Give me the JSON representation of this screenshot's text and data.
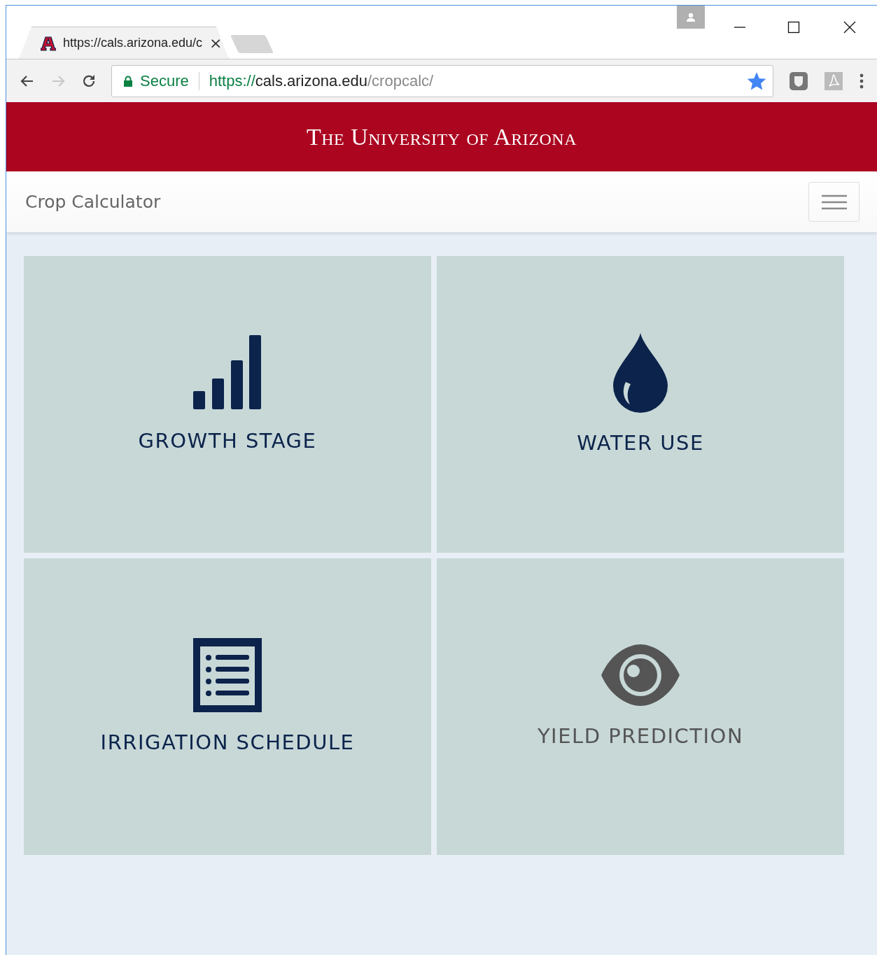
{
  "browser": {
    "tab": {
      "title": "https://cals.arizona.edu/c",
      "close": "×"
    },
    "address": {
      "secure_label": "Secure",
      "scheme": "https://",
      "host": "cals.arizona.edu",
      "path": "/cropcalc/",
      "bookmarked": true
    }
  },
  "banner": {
    "title": "The University of Arizona"
  },
  "navbar": {
    "brand": "Crop Calculator"
  },
  "tiles": [
    {
      "kind": "bars",
      "label": "GROWTH STAGE",
      "disabled": false
    },
    {
      "kind": "drop",
      "label": "WATER USE",
      "disabled": false
    },
    {
      "kind": "list",
      "label": "IRRIGATION SCHEDULE",
      "disabled": false
    },
    {
      "kind": "eye",
      "label": "YIELD PREDICTION",
      "disabled": true
    }
  ]
}
